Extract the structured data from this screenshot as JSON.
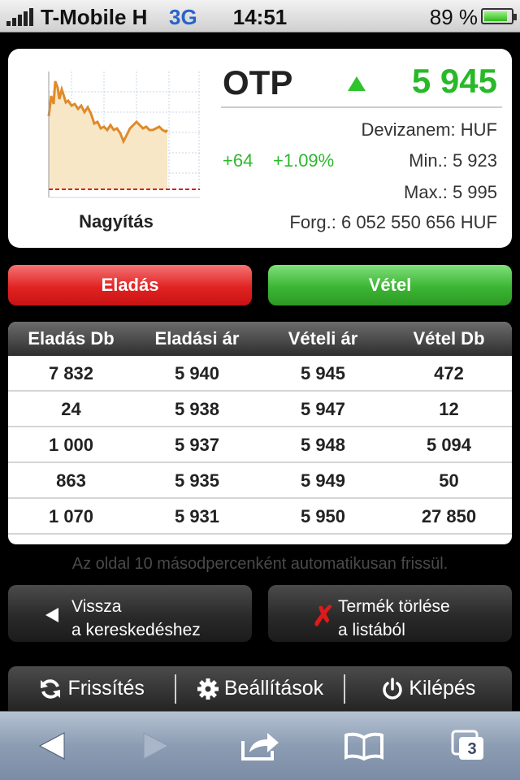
{
  "status_bar": {
    "carrier": "T-Mobile H",
    "network": "3G",
    "time": "14:51",
    "battery_percent": "89 %"
  },
  "quote": {
    "ticker": "OTP",
    "trend": "up",
    "price": "5 945",
    "currency_label": "Devizanem: HUF",
    "change_abs": "+64",
    "change_pct": "+1.09%",
    "min": "Min.: 5 923",
    "max": "Max.: 5 995",
    "turnover": "Forg.: 6 052 550 656 HUF",
    "zoom_label": "Nagyítás"
  },
  "intraday_chart": {
    "grid": true,
    "series_color": "#e08a2a",
    "fill_color": "#f7e7c6",
    "reference_line_color": "#d62020"
  },
  "actions": {
    "sell_label": "Eladás",
    "buy_label": "Vétel"
  },
  "orderbook": {
    "headers": [
      "Eladás Db",
      "Eladási ár",
      "Vételi ár",
      "Vétel Db"
    ],
    "rows": [
      [
        "7 832",
        "5 940",
        "5 945",
        "472"
      ],
      [
        "24",
        "5 938",
        "5 947",
        "12"
      ],
      [
        "1 000",
        "5 937",
        "5 948",
        "5 094"
      ],
      [
        "863",
        "5 935",
        "5 949",
        "50"
      ],
      [
        "1 070",
        "5 931",
        "5 950",
        "27 850"
      ]
    ]
  },
  "auto_refresh_note": "Az oldal 10 másodpercenként automatikusan frissül.",
  "nav": {
    "back_line1": "Vissza",
    "back_line2": "a kereskedéshez",
    "delete_line1": "Termék törlése",
    "delete_line2": "a listából"
  },
  "menu": {
    "refresh": "Frissítés",
    "settings": "Beállítások",
    "logout": "Kilépés"
  },
  "safari_toolbar": {
    "tabs_count": "3"
  },
  "colors": {
    "up_green": "#28b928",
    "sell_red": "#e12323",
    "buy_green": "#3cb534"
  }
}
